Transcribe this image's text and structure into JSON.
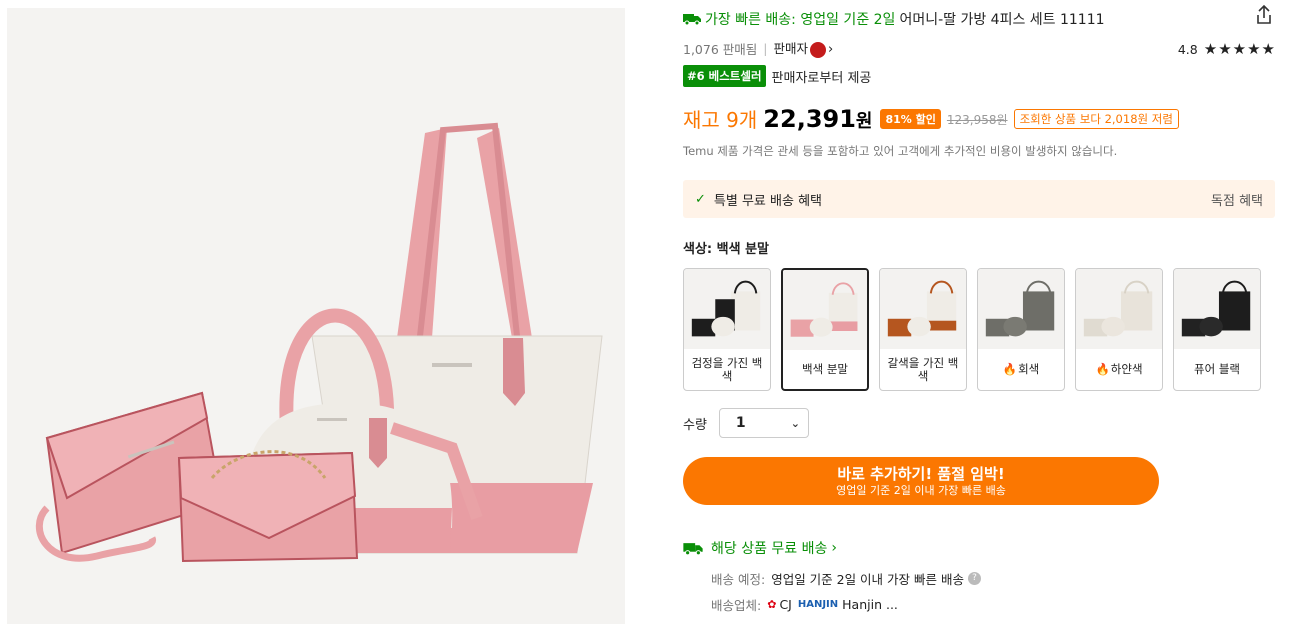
{
  "product": {
    "shipping_lead": "가장 빠른 배송: 영업일 기준 2일",
    "title": "어머니-딸 가방 4피스 세트 11111",
    "sold_count": "1,076 판매됨",
    "seller_label": "판매자",
    "rating": "4.8",
    "stars": "★★★★★",
    "bestseller_badge": "#6 베스트셀러",
    "provided_by": "판매자로부터 제공"
  },
  "price": {
    "stock": "재고 9개",
    "current": "22,391",
    "currency": "원",
    "discount": "81% 할인",
    "original": "123,958원",
    "cheaper_note": "조회한 상품 보다 2,018원 저렴",
    "tax_note": "Temu 제품 가격은 관세 등을 포함하고 있어 고객에게 추가적인 비용이 발생하지 않습니다."
  },
  "promo": {
    "label": "특별 무료 배송 혜택",
    "right": "독점 혜택"
  },
  "color": {
    "label": "색상: 백색 분말",
    "options": [
      {
        "label": "검정을 가진 백색",
        "flame": false
      },
      {
        "label": "백색 분말",
        "flame": false
      },
      {
        "label": "갈색을 가진 백색",
        "flame": false
      },
      {
        "label": "회색",
        "flame": true
      },
      {
        "label": "하얀색",
        "flame": true
      },
      {
        "label": "퓨어 블랙",
        "flame": false
      }
    ]
  },
  "quantity": {
    "label": "수량",
    "value": "1"
  },
  "cta": {
    "main": "바로 추가하기! 품절 임박!",
    "sub": "영업일 기준 2일 이내 가장 빠른 배송"
  },
  "shipping": {
    "heading": "해당 상품 무료 배송",
    "eta_key": "배송 예정:",
    "eta_value": "영업일 기준 2일 이내 가장 빠른 배송",
    "carrier_key": "배송업체:",
    "carrier_cj": "CJ",
    "carrier_hanjin_logo": "HANJIN",
    "carrier_hanjin": "Hanjin ..."
  },
  "colors": {
    "accent_orange": "#fb7701",
    "green": "#0a8f08",
    "pink": "#e8a4a8",
    "cream": "#efece6"
  }
}
